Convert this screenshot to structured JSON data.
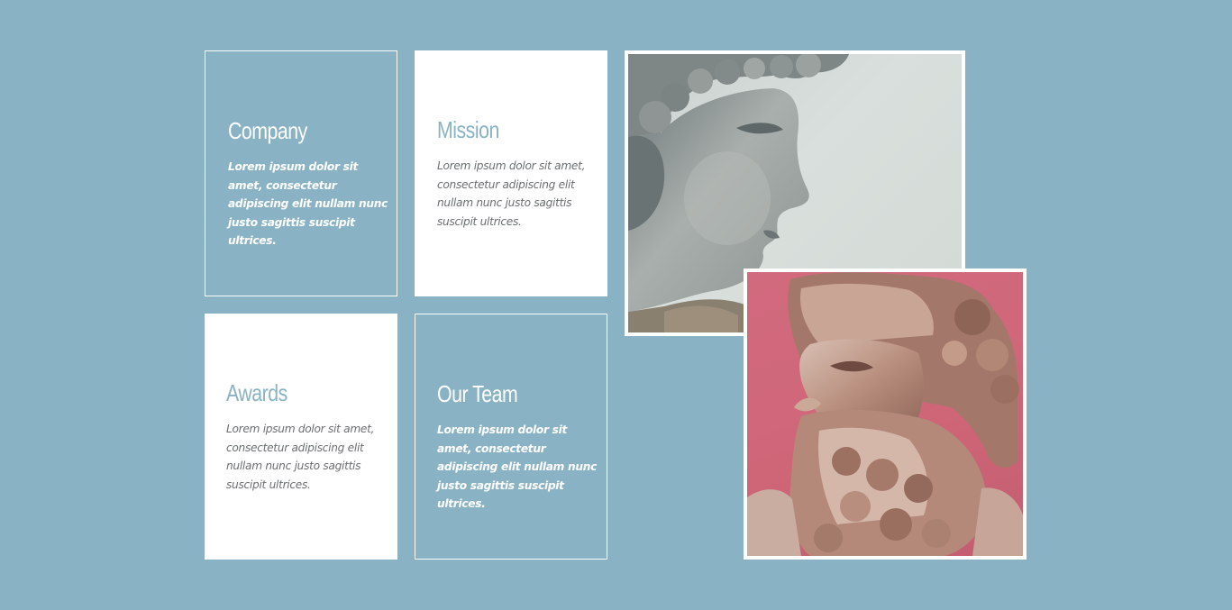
{
  "cards": [
    {
      "title": "Company",
      "body": "Lorem ipsum dolor sit amet, consectetur adipiscing elit nullam nunc justo sagittis suscipit ultrices."
    },
    {
      "title": "Mission",
      "body": "Lorem ipsum dolor sit amet, consectetur adipiscing elit nullam nunc justo sagittis suscipit ultrices."
    },
    {
      "title": "Awards",
      "body": "Lorem ipsum dolor sit amet, consectetur adipiscing elit nullam nunc justo sagittis suscipit ultrices."
    },
    {
      "title": "Our Team",
      "body": "Lorem ipsum dolor sit amet, consectetur adipiscing elit nullam nunc justo sagittis suscipit ultrices."
    }
  ],
  "colors": {
    "background": "#89b3c4",
    "card_solid": "#ffffff",
    "accent_title": "#89b3c4",
    "body_text_dark": "#6b6f72"
  }
}
